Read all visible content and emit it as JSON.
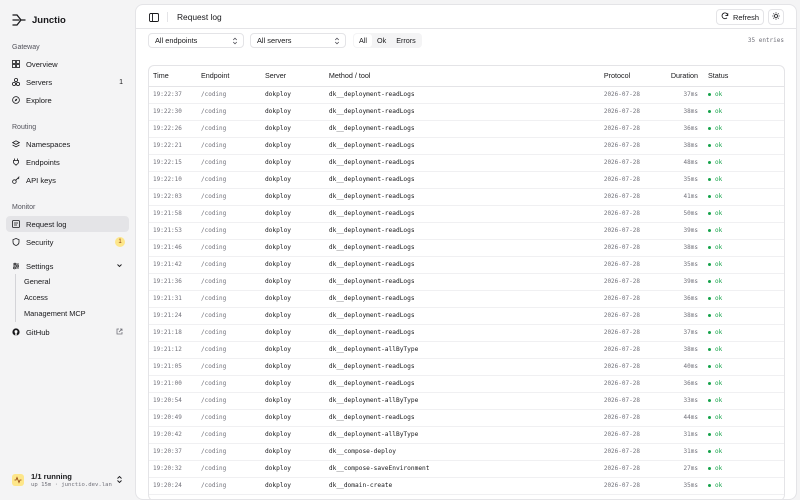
{
  "brand": {
    "name": "Junctio"
  },
  "sidebar": {
    "sections": [
      {
        "label": "Gateway"
      },
      {
        "label": "Routing"
      },
      {
        "label": "Monitor"
      }
    ],
    "items": {
      "overview": {
        "label": "Overview",
        "icon": "grid-icon"
      },
      "servers": {
        "label": "Servers",
        "count": "1",
        "icon": "servers-icon"
      },
      "explore": {
        "label": "Explore",
        "icon": "compass-icon"
      },
      "namespaces": {
        "label": "Namespaces",
        "icon": "layers-icon"
      },
      "endpoints": {
        "label": "Endpoints",
        "icon": "plug-icon"
      },
      "api_keys": {
        "label": "API keys",
        "icon": "key-icon"
      },
      "request_log": {
        "label": "Request log",
        "icon": "list-icon",
        "active": true
      },
      "security": {
        "label": "Security",
        "badge": "1",
        "icon": "shield-icon"
      },
      "settings": {
        "label": "Settings",
        "icon": "gear-icon",
        "expanded": true
      },
      "github": {
        "label": "GitHub",
        "icon": "github-icon"
      }
    },
    "settings_sub": [
      {
        "label": "General"
      },
      {
        "label": "Access"
      },
      {
        "label": "Management MCP"
      }
    ],
    "status": {
      "title": "1/1 running",
      "subtitle": "up 15m · junctio.dev.lan"
    }
  },
  "header": {
    "title": "Request log",
    "refresh_label": "Refresh"
  },
  "filters": {
    "endpoint_select": "All endpoints",
    "server_select": "All servers",
    "segments": [
      "All",
      "Ok",
      "Errors"
    ],
    "selected_segment": "All",
    "entries_label": "35 entries"
  },
  "table": {
    "columns": [
      "Time",
      "Endpoint",
      "Server",
      "Method / tool",
      "Protocol",
      "Duration",
      "Status"
    ],
    "rows": [
      [
        "19:22:37",
        "/coding",
        "dokploy",
        "dk__deployment-readLogs",
        "2026-07-28",
        "37ms",
        "ok"
      ],
      [
        "19:22:30",
        "/coding",
        "dokploy",
        "dk__deployment-readLogs",
        "2026-07-28",
        "38ms",
        "ok"
      ],
      [
        "19:22:26",
        "/coding",
        "dokploy",
        "dk__deployment-readLogs",
        "2026-07-28",
        "36ms",
        "ok"
      ],
      [
        "19:22:21",
        "/coding",
        "dokploy",
        "dk__deployment-readLogs",
        "2026-07-28",
        "38ms",
        "ok"
      ],
      [
        "19:22:15",
        "/coding",
        "dokploy",
        "dk__deployment-readLogs",
        "2026-07-28",
        "48ms",
        "ok"
      ],
      [
        "19:22:10",
        "/coding",
        "dokploy",
        "dk__deployment-readLogs",
        "2026-07-28",
        "35ms",
        "ok"
      ],
      [
        "19:22:03",
        "/coding",
        "dokploy",
        "dk__deployment-readLogs",
        "2026-07-28",
        "41ms",
        "ok"
      ],
      [
        "19:21:58",
        "/coding",
        "dokploy",
        "dk__deployment-readLogs",
        "2026-07-28",
        "50ms",
        "ok"
      ],
      [
        "19:21:53",
        "/coding",
        "dokploy",
        "dk__deployment-readLogs",
        "2026-07-28",
        "39ms",
        "ok"
      ],
      [
        "19:21:46",
        "/coding",
        "dokploy",
        "dk__deployment-readLogs",
        "2026-07-28",
        "38ms",
        "ok"
      ],
      [
        "19:21:42",
        "/coding",
        "dokploy",
        "dk__deployment-readLogs",
        "2026-07-28",
        "35ms",
        "ok"
      ],
      [
        "19:21:36",
        "/coding",
        "dokploy",
        "dk__deployment-readLogs",
        "2026-07-28",
        "39ms",
        "ok"
      ],
      [
        "19:21:31",
        "/coding",
        "dokploy",
        "dk__deployment-readLogs",
        "2026-07-28",
        "36ms",
        "ok"
      ],
      [
        "19:21:24",
        "/coding",
        "dokploy",
        "dk__deployment-readLogs",
        "2026-07-28",
        "38ms",
        "ok"
      ],
      [
        "19:21:18",
        "/coding",
        "dokploy",
        "dk__deployment-readLogs",
        "2026-07-28",
        "37ms",
        "ok"
      ],
      [
        "19:21:12",
        "/coding",
        "dokploy",
        "dk__deployment-allByType",
        "2026-07-28",
        "38ms",
        "ok"
      ],
      [
        "19:21:05",
        "/coding",
        "dokploy",
        "dk__deployment-readLogs",
        "2026-07-28",
        "40ms",
        "ok"
      ],
      [
        "19:21:00",
        "/coding",
        "dokploy",
        "dk__deployment-readLogs",
        "2026-07-28",
        "36ms",
        "ok"
      ],
      [
        "19:20:54",
        "/coding",
        "dokploy",
        "dk__deployment-allByType",
        "2026-07-28",
        "33ms",
        "ok"
      ],
      [
        "19:20:49",
        "/coding",
        "dokploy",
        "dk__deployment-readLogs",
        "2026-07-28",
        "44ms",
        "ok"
      ],
      [
        "19:20:42",
        "/coding",
        "dokploy",
        "dk__deployment-allByType",
        "2026-07-28",
        "31ms",
        "ok"
      ],
      [
        "19:20:37",
        "/coding",
        "dokploy",
        "dk__compose-deploy",
        "2026-07-28",
        "31ms",
        "ok"
      ],
      [
        "19:20:32",
        "/coding",
        "dokploy",
        "dk__compose-saveEnvironment",
        "2026-07-28",
        "27ms",
        "ok"
      ],
      [
        "19:20:24",
        "/coding",
        "dokploy",
        "dk__domain-create",
        "2026-07-28",
        "35ms",
        "ok"
      ]
    ]
  },
  "colors": {
    "ok": "#16a34a",
    "badge_bg": "#fde68a",
    "accent": "#18181b"
  }
}
